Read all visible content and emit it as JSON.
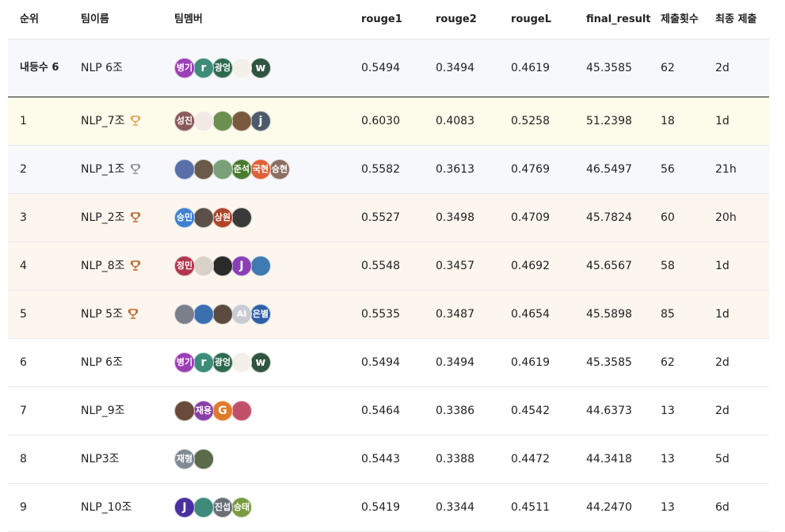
{
  "headers": {
    "rank": "순위",
    "team": "팀이름",
    "members": "팀멤버",
    "rouge1": "rouge1",
    "rouge2": "rouge2",
    "rougeL": "rougeL",
    "final": "final_result",
    "submissions": "제출횟수",
    "last_submission": "최종 제출"
  },
  "my_team": {
    "rank": "내등수 6",
    "team": "NLP 6조",
    "members": [
      {
        "label": "병기",
        "color": "#9b3fb5"
      },
      {
        "label": "r",
        "color": "#3d8c7a"
      },
      {
        "label": "광엉",
        "color": "#2e6a4f"
      },
      {
        "label": "",
        "color": "#f3efe9"
      },
      {
        "label": "w",
        "color": "#2f5440"
      }
    ],
    "rouge1": "0.5494",
    "rouge2": "0.3494",
    "rougeL": "0.4619",
    "final": "45.3585",
    "submissions": "62",
    "last": "2d"
  },
  "rows": [
    {
      "rank": "1",
      "team": "NLP_7조",
      "trophy": "gold",
      "trophy_color": "#e0a24a",
      "members": [
        {
          "label": "성진",
          "color": "#8a5a5a"
        },
        {
          "label": "",
          "color": "#f2e9e7"
        },
        {
          "label": "",
          "color": "#6b8f4f"
        },
        {
          "label": "",
          "color": "#7a5a3f"
        },
        {
          "label": "j",
          "color": "#4d5a6a"
        }
      ],
      "rouge1": "0.6030",
      "rouge2": "0.4083",
      "rougeL": "0.5258",
      "final": "51.2398",
      "submissions": "18",
      "last": "1d"
    },
    {
      "rank": "2",
      "team": "NLP_1조",
      "trophy": "silver",
      "trophy_color": "#8a8f99",
      "members": [
        {
          "label": "",
          "color": "#5a6fa8"
        },
        {
          "label": "",
          "color": "#6a5a4a"
        },
        {
          "label": "",
          "color": "#7aa07a"
        },
        {
          "label": "준석",
          "color": "#4a7a2f"
        },
        {
          "label": "국현",
          "color": "#e0603a"
        },
        {
          "label": "승현",
          "color": "#8a6f62"
        }
      ],
      "rouge1": "0.5582",
      "rouge2": "0.3613",
      "rougeL": "0.4769",
      "final": "46.5497",
      "submissions": "56",
      "last": "21h"
    },
    {
      "rank": "3",
      "team": "NLP_2조",
      "trophy": "bronze",
      "trophy_color": "#b8642a",
      "members": [
        {
          "label": "승민",
          "color": "#3d7fd0"
        },
        {
          "label": "",
          "color": "#5a5048"
        },
        {
          "label": "상원",
          "color": "#b0452a"
        },
        {
          "label": "",
          "color": "#3a3a3a"
        }
      ],
      "rouge1": "0.5527",
      "rouge2": "0.3498",
      "rougeL": "0.4709",
      "final": "45.7824",
      "submissions": "60",
      "last": "20h"
    },
    {
      "rank": "4",
      "team": "NLP_8조",
      "trophy": "bronze",
      "trophy_color": "#b8642a",
      "members": [
        {
          "label": "정민",
          "color": "#b2364f"
        },
        {
          "label": "",
          "color": "#d9d2c8"
        },
        {
          "label": "",
          "color": "#2a2a2a"
        },
        {
          "label": "J",
          "color": "#8a3fb5"
        },
        {
          "label": "",
          "color": "#3f7ab0"
        }
      ],
      "rouge1": "0.5548",
      "rouge2": "0.3457",
      "rougeL": "0.4692",
      "final": "45.6567",
      "submissions": "58",
      "last": "1d"
    },
    {
      "rank": "5",
      "team": "NLP 5조",
      "trophy": "bronze",
      "trophy_color": "#b8642a",
      "members": [
        {
          "label": "",
          "color": "#7a7f8a"
        },
        {
          "label": "",
          "color": "#3a6fb0"
        },
        {
          "label": "",
          "color": "#5a4a3f"
        },
        {
          "label": "AI",
          "color": "#c9ccd2"
        },
        {
          "label": "은별",
          "color": "#2f5fa8"
        }
      ],
      "rouge1": "0.5535",
      "rouge2": "0.3487",
      "rougeL": "0.4654",
      "final": "45.5898",
      "submissions": "85",
      "last": "1d"
    },
    {
      "rank": "6",
      "team": "NLP 6조",
      "trophy": "",
      "trophy_color": "",
      "members": [
        {
          "label": "병기",
          "color": "#9b3fb5"
        },
        {
          "label": "r",
          "color": "#3d8c7a"
        },
        {
          "label": "광엉",
          "color": "#2e6a4f"
        },
        {
          "label": "",
          "color": "#f3efe9"
        },
        {
          "label": "w",
          "color": "#2f5440"
        }
      ],
      "rouge1": "0.5494",
      "rouge2": "0.3494",
      "rougeL": "0.4619",
      "final": "45.3585",
      "submissions": "62",
      "last": "2d"
    },
    {
      "rank": "7",
      "team": "NLP_9조",
      "trophy": "",
      "trophy_color": "",
      "members": [
        {
          "label": "",
          "color": "#6a4a3a"
        },
        {
          "label": "재용",
          "color": "#8a3fa8"
        },
        {
          "label": "G",
          "color": "#e07a2a"
        },
        {
          "label": "",
          "color": "#c0506a"
        }
      ],
      "rouge1": "0.5464",
      "rouge2": "0.3386",
      "rougeL": "0.4542",
      "final": "44.6373",
      "submissions": "13",
      "last": "2d"
    },
    {
      "rank": "8",
      "team": "NLP3조",
      "trophy": "",
      "trophy_color": "",
      "members": [
        {
          "label": "재형",
          "color": "#7f8a95"
        },
        {
          "label": "",
          "color": "#5a6a4a"
        }
      ],
      "rouge1": "0.5443",
      "rouge2": "0.3388",
      "rougeL": "0.4472",
      "final": "44.3418",
      "submissions": "13",
      "last": "5d"
    },
    {
      "rank": "9",
      "team": "NLP_10조",
      "trophy": "",
      "trophy_color": "",
      "members": [
        {
          "label": "J",
          "color": "#4a2fa0"
        },
        {
          "label": "",
          "color": "#3f8a7a"
        },
        {
          "label": "진섭",
          "color": "#6a6f78"
        },
        {
          "label": "승태",
          "color": "#7a9a3f"
        }
      ],
      "rouge1": "0.5419",
      "rouge2": "0.3344",
      "rougeL": "0.4511",
      "final": "44.2470",
      "submissions": "13",
      "last": "6d"
    }
  ]
}
